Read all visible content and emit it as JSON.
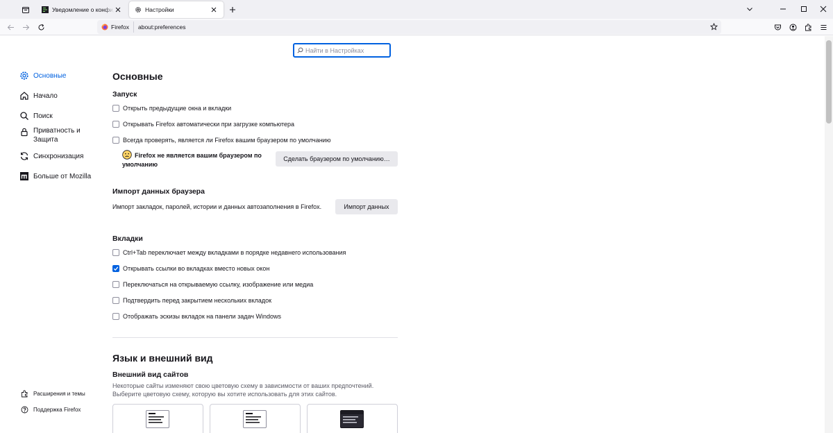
{
  "tabs": [
    {
      "label": "Уведомление о конфиденциальности",
      "icon": "privacy-notice-favicon"
    },
    {
      "label": "Настройки",
      "icon": "gear-icon"
    }
  ],
  "navbar": {
    "identity_label": "Firefox",
    "url": "about:preferences"
  },
  "search": {
    "placeholder": "Найти в Настройках"
  },
  "sidebar": {
    "items": [
      {
        "label": "Основные",
        "icon": "gear-icon",
        "selected": true
      },
      {
        "label": "Начало",
        "icon": "home-icon"
      },
      {
        "label": "Поиск",
        "icon": "search-icon"
      },
      {
        "label": "Приватность и Защита",
        "line1": "Приватность и",
        "line2": "Защита",
        "icon": "lock-icon"
      },
      {
        "label": "Синхронизация",
        "icon": "sync-icon"
      },
      {
        "label": "Больше от Mozilla",
        "icon": "mozilla-icon"
      }
    ],
    "footer": [
      {
        "label": "Расширения и темы",
        "icon": "puzzle-icon"
      },
      {
        "label": "Поддержка Firefox",
        "icon": "help-icon"
      }
    ]
  },
  "main": {
    "title": "Основные",
    "startup": {
      "heading": "Запуск",
      "options": [
        {
          "label": "Открыть предыдущие окна и вкладки",
          "checked": false
        },
        {
          "label": "Открывать Firefox автоматически при загрузке компьютера",
          "checked": false
        },
        {
          "label": "Всегда проверять, является ли Firefox вашим браузером по умолчанию",
          "checked": false
        }
      ],
      "default_note": "Firefox не является вашим браузером по умолчанию",
      "default_button": "Сделать браузером по умолчанию…"
    },
    "import": {
      "heading": "Импорт данных браузера",
      "description": "Импорт закладок, паролей, истории и данных автозаполнения в Firefox.",
      "button": "Импорт данных"
    },
    "tabs_section": {
      "heading": "Вкладки",
      "options": [
        {
          "label": "Ctrl+Tab переключает между вкладками в порядке недавнего использования",
          "checked": false
        },
        {
          "label": "Открывать ссылки во вкладках вместо новых окон",
          "checked": true
        },
        {
          "label": "Переключаться на открываемую ссылку, изображение или медиа",
          "checked": false
        },
        {
          "label": "Подтвердить перед закрытием нескольких вкладок",
          "checked": false
        },
        {
          "label": "Отображать эскизы вкладок на панели задач Windows",
          "checked": false
        }
      ]
    },
    "language": {
      "title": "Язык и внешний вид",
      "appearance_heading": "Внешний вид сайтов",
      "appearance_desc_1": "Некоторые сайты изменяют свою цветовую схему в зависимости от ваших предпочтений.",
      "appearance_desc_2": "Выберите цветовую схему, которую вы хотите использовать для этих сайтов.",
      "themes": [
        "auto",
        "light",
        "dark"
      ]
    }
  },
  "colors": {
    "accent": "#0061e0",
    "tabstrip": "#f0f0f4"
  }
}
